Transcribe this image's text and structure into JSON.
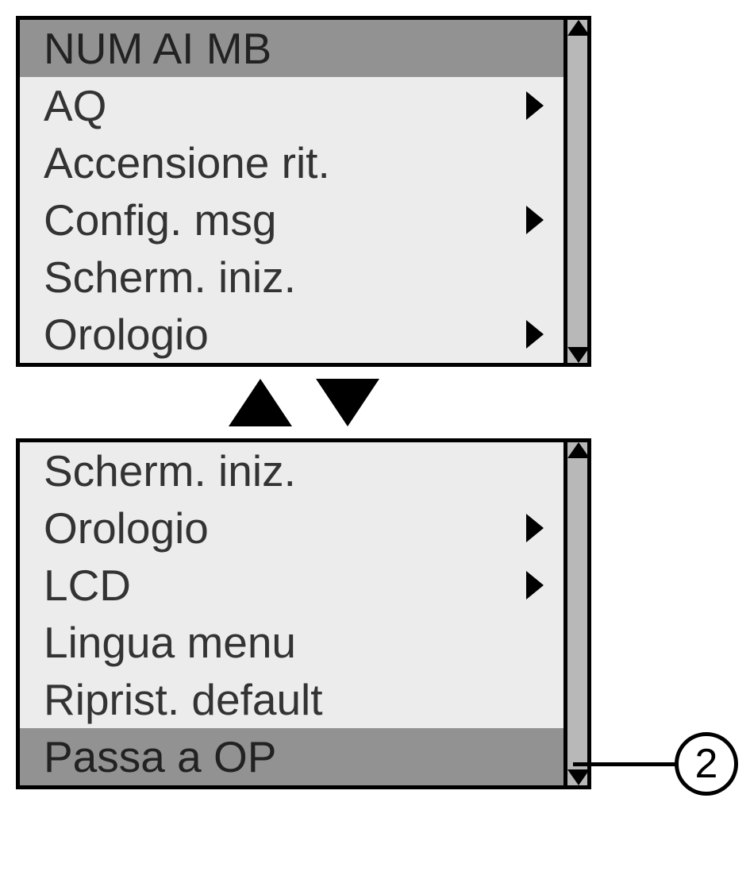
{
  "screen1": {
    "items": [
      {
        "label": "NUM AI MB",
        "selected": true,
        "submenu": false
      },
      {
        "label": "AQ",
        "selected": false,
        "submenu": true
      },
      {
        "label": "Accensione rit.",
        "selected": false,
        "submenu": false
      },
      {
        "label": "Config. msg",
        "selected": false,
        "submenu": true
      },
      {
        "label": "Scherm. iniz.",
        "selected": false,
        "submenu": false
      },
      {
        "label": "Orologio",
        "selected": false,
        "submenu": true
      }
    ]
  },
  "screen2": {
    "items": [
      {
        "label": "Scherm. iniz.",
        "selected": false,
        "submenu": false
      },
      {
        "label": "Orologio",
        "selected": false,
        "submenu": true
      },
      {
        "label": "LCD",
        "selected": false,
        "submenu": true
      },
      {
        "label": "Lingua menu",
        "selected": false,
        "submenu": false
      },
      {
        "label": "Riprist. default",
        "selected": false,
        "submenu": false
      },
      {
        "label": "Passa a OP",
        "selected": true,
        "submenu": false
      }
    ]
  },
  "callout": {
    "number": "2"
  }
}
